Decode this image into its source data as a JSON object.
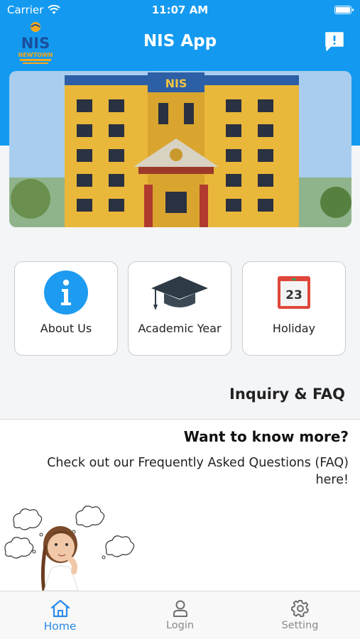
{
  "status_bar": {
    "carrier": "Carrier",
    "time": "11:07 AM"
  },
  "header": {
    "title": "NIS App",
    "logo_text": "NIS",
    "logo_subtext": "NEWTOWN"
  },
  "banner": {
    "building_sign": "NIS"
  },
  "quick_links": [
    {
      "label": "About Us",
      "icon": "info-icon"
    },
    {
      "label": "Academic Year",
      "icon": "graduation-cap-icon"
    },
    {
      "label": "Holiday",
      "icon": "calendar-icon",
      "day": "23"
    }
  ],
  "inquiry": {
    "section_title": "Inquiry & FAQ",
    "heading": "Want to know more?",
    "text": "Check out our Frequently Asked Questions (FAQ) here!"
  },
  "tabs": [
    {
      "label": "Home",
      "icon": "home-icon",
      "active": true
    },
    {
      "label": "Login",
      "icon": "user-icon",
      "active": false
    },
    {
      "label": "Setting",
      "icon": "gear-icon",
      "active": false
    }
  ],
  "colors": {
    "primary": "#139af0",
    "active_tab": "#2a8be8",
    "info_icon": "#1d9bf0",
    "calendar_red": "#e0463a"
  }
}
